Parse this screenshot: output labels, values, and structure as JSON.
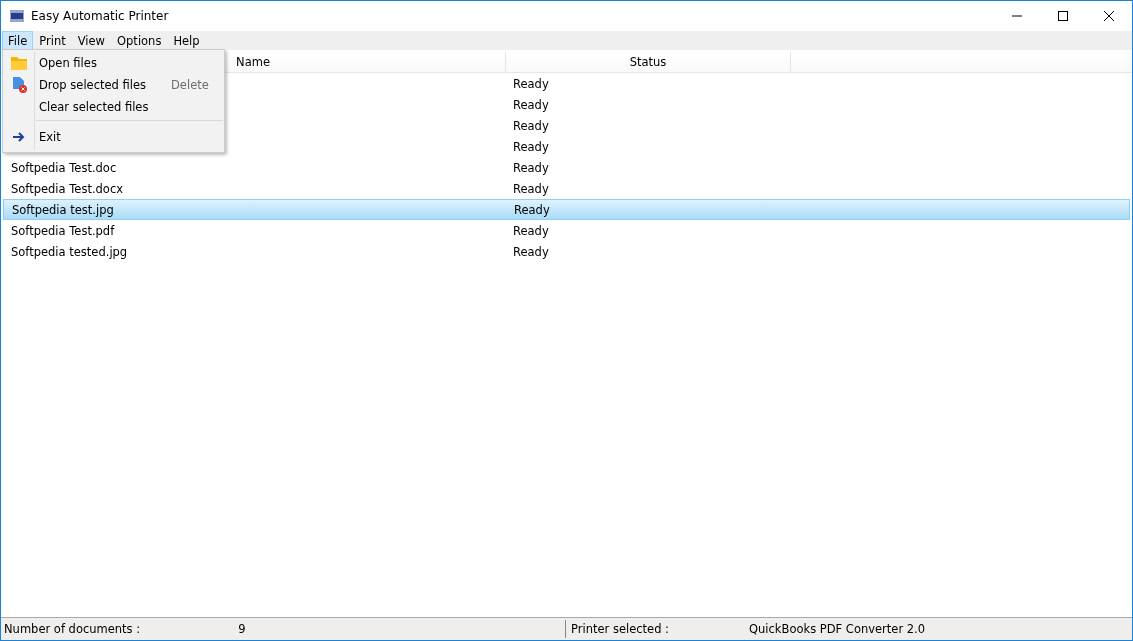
{
  "window": {
    "title": "Easy Automatic Printer"
  },
  "menu_bar": [
    {
      "label": "File",
      "selected": true
    },
    {
      "label": "Print",
      "selected": false
    },
    {
      "label": "View",
      "selected": false
    },
    {
      "label": "Options",
      "selected": false
    },
    {
      "label": "Help",
      "selected": false
    }
  ],
  "file_menu": [
    {
      "kind": "item",
      "label": "Open files"
    },
    {
      "kind": "item",
      "label": "Drop selected files",
      "shortcut": "Delete"
    },
    {
      "kind": "item",
      "label": "Clear selected files"
    },
    {
      "kind": "separator"
    },
    {
      "kind": "item",
      "label": "Exit"
    }
  ],
  "table": {
    "columns": [
      "Name",
      "Status"
    ],
    "rows": [
      {
        "status": "Ready",
        "selected": false
      },
      {
        "status": "Ready",
        "selected": false
      },
      {
        "status": "Ready",
        "selected": false
      },
      {
        "status": "Ready",
        "selected": false
      },
      {
        "name": "Softpedia Test.doc",
        "status": "Ready",
        "selected": false
      },
      {
        "name": "Softpedia Test.docx",
        "status": "Ready",
        "selected": false
      },
      {
        "name": "Softpedia test.jpg",
        "status": "Ready",
        "selected": true
      },
      {
        "name": "Softpedia Test.pdf",
        "status": "Ready",
        "selected": false
      },
      {
        "name": "Softpedia tested.jpg",
        "status": "Ready",
        "selected": false
      }
    ]
  },
  "status_bar": {
    "documents_label": "Number of documents :",
    "documents_count": "9",
    "printer_label": "Printer selected :",
    "printer_value": "QuickBooks PDF Converter 2.0"
  }
}
